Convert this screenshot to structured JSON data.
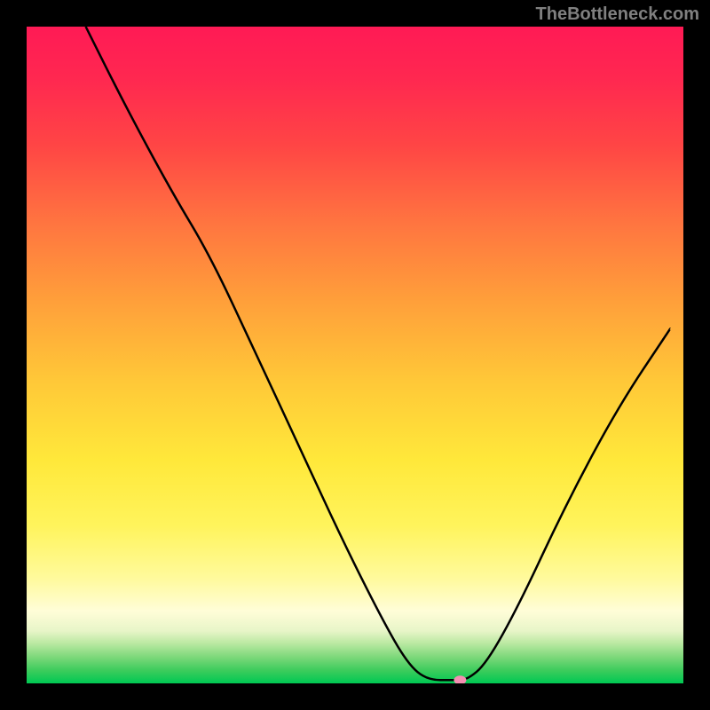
{
  "watermark": "TheBottleneck.com",
  "chart_data": {
    "type": "line",
    "title": "",
    "xlabel": "",
    "ylabel": "",
    "xlim": [
      0,
      100
    ],
    "ylim": [
      0,
      100
    ],
    "gradient_stops": [
      {
        "offset": 0,
        "color": "#ff1744"
      },
      {
        "offset": 15,
        "color": "#ff3d3d"
      },
      {
        "offset": 35,
        "color": "#ff8a3d"
      },
      {
        "offset": 50,
        "color": "#ffc83d"
      },
      {
        "offset": 65,
        "color": "#ffeb3d"
      },
      {
        "offset": 80,
        "color": "#fff176"
      },
      {
        "offset": 88,
        "color": "#fff9c4"
      },
      {
        "offset": 93,
        "color": "#c5e1a5"
      },
      {
        "offset": 96,
        "color": "#66bb6a"
      },
      {
        "offset": 100,
        "color": "#00c853"
      }
    ],
    "curve_points": [
      {
        "x": 9,
        "y": 100
      },
      {
        "x": 15,
        "y": 88
      },
      {
        "x": 22,
        "y": 75
      },
      {
        "x": 28,
        "y": 65
      },
      {
        "x": 35,
        "y": 50
      },
      {
        "x": 42,
        "y": 35
      },
      {
        "x": 48,
        "y": 22
      },
      {
        "x": 54,
        "y": 10
      },
      {
        "x": 58,
        "y": 3
      },
      {
        "x": 61,
        "y": 0.5
      },
      {
        "x": 65,
        "y": 0.5
      },
      {
        "x": 67,
        "y": 0.5
      },
      {
        "x": 70,
        "y": 3
      },
      {
        "x": 75,
        "y": 12
      },
      {
        "x": 82,
        "y": 27
      },
      {
        "x": 90,
        "y": 42
      },
      {
        "x": 98,
        "y": 54
      }
    ],
    "marker": {
      "x": 66,
      "y": 0.5,
      "color": "#f48fb1"
    }
  }
}
